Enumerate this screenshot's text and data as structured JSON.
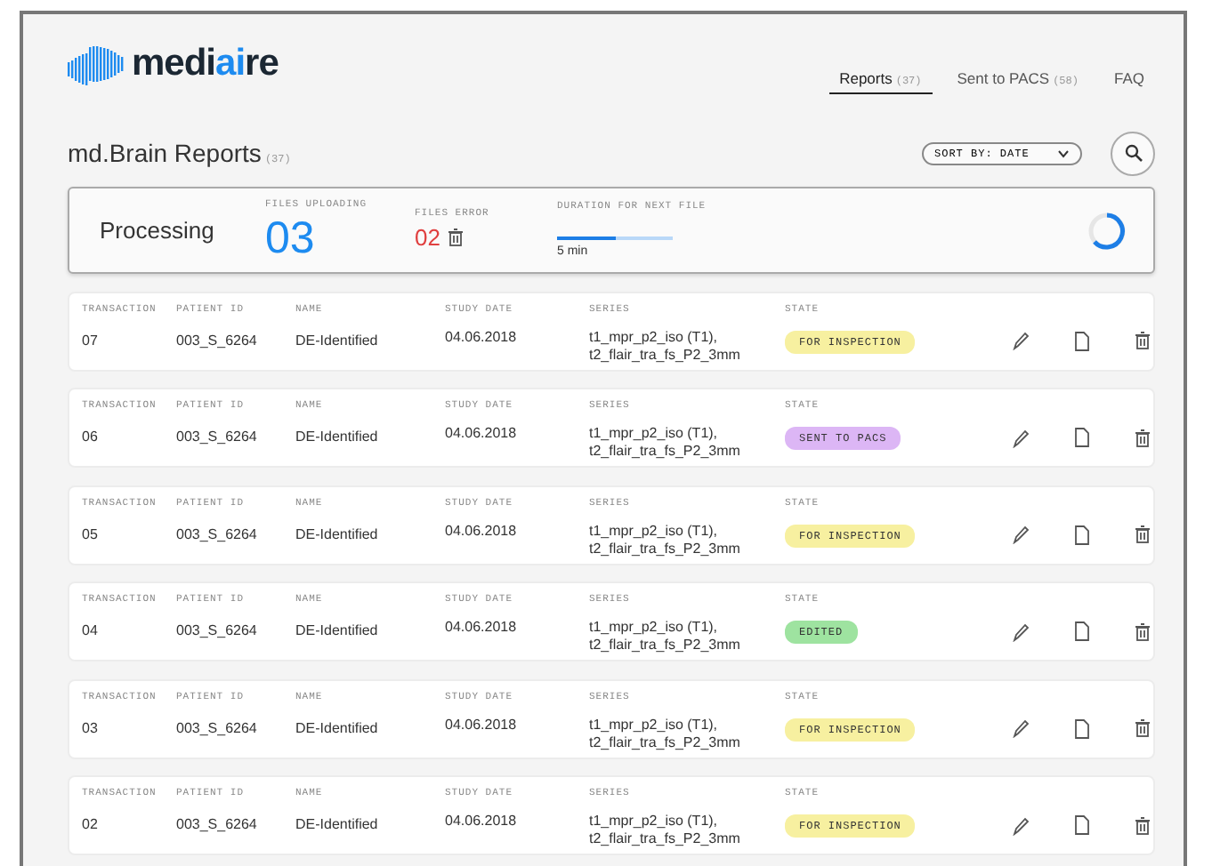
{
  "logo": {
    "text_start": "medi",
    "text_accent": "ai",
    "text_end": "re"
  },
  "nav": [
    {
      "label": "Reports",
      "count": "(37)",
      "selected": true
    },
    {
      "label": "Sent to PACS",
      "count": "(58)",
      "selected": false
    },
    {
      "label": "FAQ",
      "selected": false
    }
  ],
  "page_title": {
    "text": "md.Brain Reports",
    "count": "(37)"
  },
  "sort": {
    "label": "SORT BY: DATE"
  },
  "processing": {
    "title": "Processing",
    "files_uploading_label": "FILES UPLOADING",
    "files_uploading": "03",
    "files_error_label": "FILES ERROR",
    "files_error": "02",
    "duration_label": "DURATION FOR NEXT FILE",
    "level": 0.5,
    "duration": "5 min"
  },
  "rows": [
    {
      "labels": [
        "TRANSACTION",
        "PATIENT ID",
        "NAME",
        "STUDY DATE",
        "SERIES",
        "STATE"
      ],
      "transaction": "07",
      "patient_id": "003_S_6264",
      "name": "DE-Identified",
      "study_date": "04.06.2018",
      "series": [
        "t1_mpr_p2_iso (T1),",
        "t2_flair_tra_fs_P2_3mm"
      ],
      "state": "FOR INSPECTION",
      "color": "#f7f0a0"
    },
    {
      "labels": [
        "TRANSACTION",
        "PATIENT ID",
        "NAME",
        "STUDY DATE",
        "SERIES",
        "STATE"
      ],
      "transaction": "06",
      "patient_id": "003_S_6264",
      "name": "DE-Identified",
      "study_date": "04.06.2018",
      "series": [
        "t1_mpr_p2_iso (T1),",
        "t2_flair_tra_fs_P2_3mm"
      ],
      "state": "SENT TO PACS",
      "color": "#dcb6f5"
    },
    {
      "labels": [
        "TRANSACTION",
        "PATIENT ID",
        "NAME",
        "STUDY DATE",
        "SERIES",
        "STATE"
      ],
      "transaction": "05",
      "patient_id": "003_S_6264",
      "name": "DE-Identified",
      "study_date": "04.06.2018",
      "series": [
        "t1_mpr_p2_iso (T1),",
        "t2_flair_tra_fs_P2_3mm"
      ],
      "state": "FOR INSPECTION",
      "color": "#f7f0a0"
    },
    {
      "labels": [
        "TRANSACTION",
        "PATIENT ID",
        "NAME",
        "STUDY DATE",
        "SERIES",
        "STATE"
      ],
      "transaction": "04",
      "patient_id": "003_S_6264",
      "name": "DE-Identified",
      "study_date": "04.06.2018",
      "series": [
        "t1_mpr_p2_iso (T1),",
        "t2_flair_tra_fs_P2_3mm"
      ],
      "state": "EDITED",
      "color": "#9ee3a0"
    },
    {
      "labels": [
        "TRANSACTION",
        "PATIENT ID",
        "NAME",
        "STUDY DATE",
        "SERIES",
        "STATE"
      ],
      "transaction": "03",
      "patient_id": "003_S_6264",
      "name": "DE-Identified",
      "study_date": "04.06.2018",
      "series": [
        "t1_mpr_p2_iso (T1),",
        "t2_flair_tra_fs_P2_3mm"
      ],
      "state": "FOR INSPECTION",
      "color": "#f7f0a0"
    },
    {
      "labels": [
        "TRANSACTION",
        "PATIENT ID",
        "NAME",
        "STUDY DATE",
        "SERIES",
        "STATE"
      ],
      "transaction": "02",
      "patient_id": "003_S_6264",
      "name": "DE-Identified",
      "study_date": "04.06.2018",
      "series": [
        "t1_mpr_p2_iso (T1),",
        "t2_flair_tra_fs_P2_3mm"
      ],
      "state": "FOR INSPECTION",
      "color": "#f7f0a0"
    }
  ]
}
